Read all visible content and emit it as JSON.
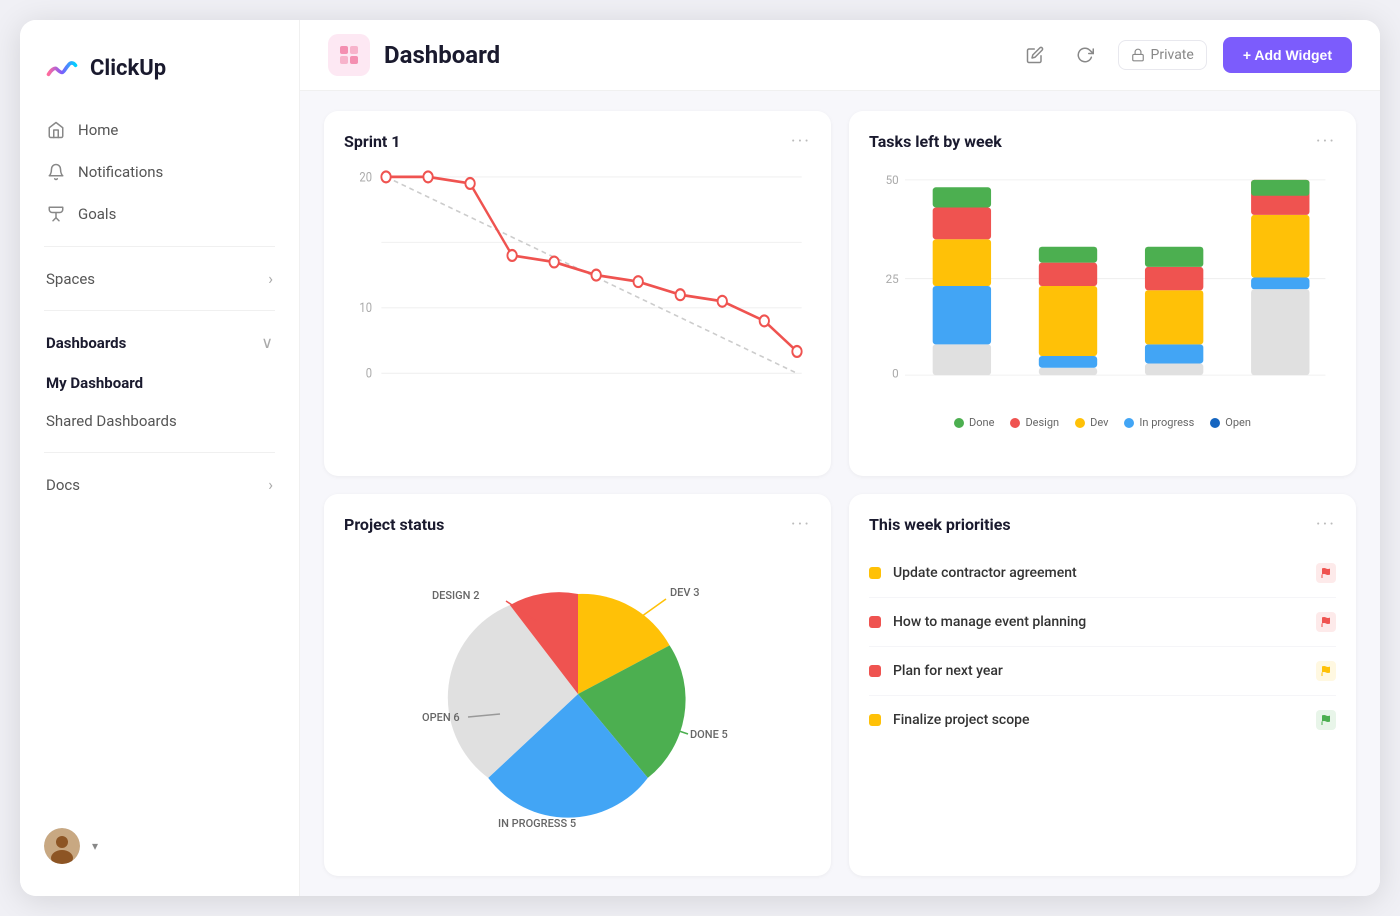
{
  "app": {
    "name": "ClickUp"
  },
  "sidebar": {
    "nav_items": [
      {
        "id": "home",
        "label": "Home",
        "icon": "home-icon"
      },
      {
        "id": "notifications",
        "label": "Notifications",
        "icon": "bell-icon"
      },
      {
        "id": "goals",
        "label": "Goals",
        "icon": "trophy-icon"
      }
    ],
    "sections": [
      {
        "id": "spaces",
        "label": "Spaces",
        "expandable": true,
        "expanded": false
      },
      {
        "id": "dashboards",
        "label": "Dashboards",
        "expandable": true,
        "expanded": true
      }
    ],
    "dashboards_sub": [
      {
        "id": "my-dashboard",
        "label": "My Dashboard",
        "active": true
      },
      {
        "id": "shared-dashboards",
        "label": "Shared Dashboards",
        "active": false
      }
    ],
    "docs": {
      "label": "Docs",
      "expandable": true
    }
  },
  "header": {
    "title": "Dashboard",
    "private_label": "Private",
    "add_widget_label": "+ Add Widget"
  },
  "sprint_card": {
    "title": "Sprint 1",
    "y_labels": [
      "20",
      "10",
      "0"
    ],
    "data_points": [
      {
        "x": 0,
        "y": 20
      },
      {
        "x": 1,
        "y": 20
      },
      {
        "x": 2,
        "y": 19
      },
      {
        "x": 3,
        "y": 15
      },
      {
        "x": 4,
        "y": 14
      },
      {
        "x": 5,
        "y": 12
      },
      {
        "x": 6,
        "y": 11
      },
      {
        "x": 7,
        "y": 10
      },
      {
        "x": 8,
        "y": 9
      },
      {
        "x": 9,
        "y": 7
      },
      {
        "x": 10,
        "y": 5
      }
    ]
  },
  "tasks_card": {
    "title": "Tasks left by week",
    "y_labels": [
      "50",
      "25",
      "0"
    ],
    "bars": [
      {
        "done": 5,
        "design": 8,
        "dev": 12,
        "in_progress": 15,
        "open": 8
      },
      {
        "done": 4,
        "design": 6,
        "dev": 18,
        "in_progress": 3,
        "open": 2
      },
      {
        "done": 5,
        "design": 6,
        "dev": 14,
        "in_progress": 5,
        "open": 3
      },
      {
        "done": 4,
        "design": 9,
        "dev": 16,
        "in_progress": 3,
        "open": 22
      }
    ],
    "legend": [
      {
        "label": "Done",
        "color": "#4caf50"
      },
      {
        "label": "Design",
        "color": "#ef5350"
      },
      {
        "label": "Dev",
        "color": "#ffc107"
      },
      {
        "label": "In progress",
        "color": "#42a5f5"
      },
      {
        "label": "Open",
        "color": "#1565c0"
      }
    ]
  },
  "project_status_card": {
    "title": "Project status",
    "segments": [
      {
        "label": "DEV 3",
        "value": 3,
        "color": "#ffc107"
      },
      {
        "label": "DONE 5",
        "value": 5,
        "color": "#4caf50"
      },
      {
        "label": "IN PROGRESS 5",
        "value": 5,
        "color": "#42a5f5"
      },
      {
        "label": "OPEN 6",
        "value": 6,
        "color": "#e0e0e0"
      },
      {
        "label": "DESIGN 2",
        "value": 2,
        "color": "#ef5350"
      }
    ]
  },
  "priorities_card": {
    "title": "This week priorities",
    "items": [
      {
        "text": "Update contractor agreement",
        "dot_color": "#ffc107",
        "flag_color": "#ef5350",
        "flag_bg": "#fdeaea"
      },
      {
        "text": "How to manage event planning",
        "dot_color": "#ef5350",
        "flag_color": "#ef5350",
        "flag_bg": "#fdeaea"
      },
      {
        "text": "Plan for next year",
        "dot_color": "#ef5350",
        "flag_color": "#ffc107",
        "flag_bg": "#fff8e1"
      },
      {
        "text": "Finalize project scope",
        "dot_color": "#ffc107",
        "flag_color": "#4caf50",
        "flag_bg": "#e8f5e9"
      }
    ]
  }
}
